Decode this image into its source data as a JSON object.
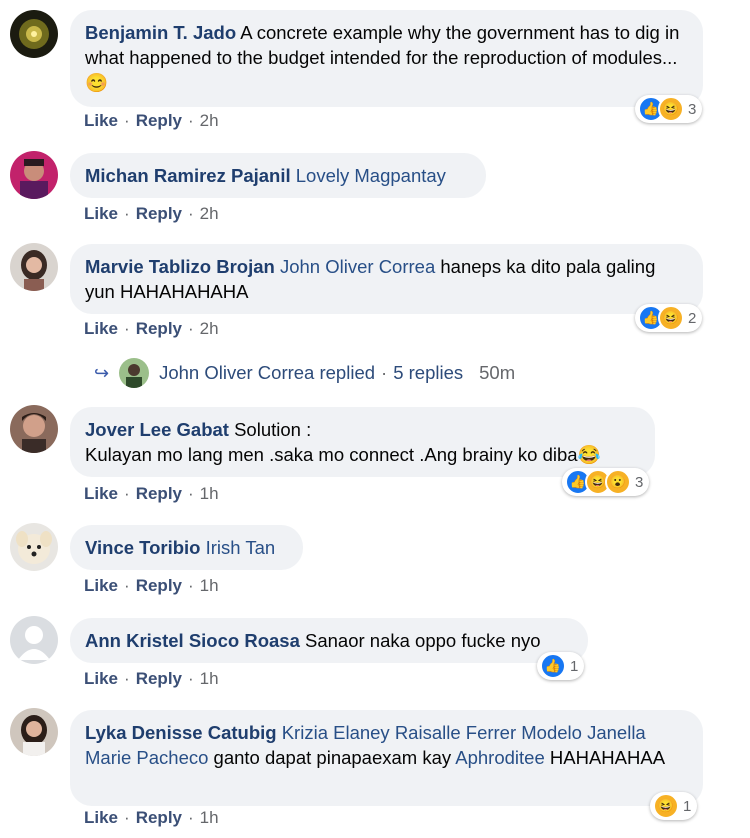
{
  "comments": [
    {
      "author": "Benjamin T. Jado",
      "text": "A concrete example why the government has to dig in what happened to the budget intended for the reproduction of modules...",
      "emoji": "😊",
      "actions": {
        "like": "Like",
        "reply": "Reply",
        "time": "2h"
      },
      "reactions": {
        "icons": [
          "like",
          "haha"
        ],
        "count": "3"
      }
    },
    {
      "author": "Michan Ramirez Pajanil",
      "tag": "Lovely Magpantay",
      "actions": {
        "like": "Like",
        "reply": "Reply",
        "time": "2h"
      }
    },
    {
      "author": "Marvie Tablizo Brojan",
      "tag": "John Oliver Correa",
      "text": "haneps ka dito pala galing yun HAHAHAHAHA",
      "actions": {
        "like": "Like",
        "reply": "Reply",
        "time": "2h"
      },
      "reactions": {
        "icons": [
          "like",
          "haha"
        ],
        "count": "2"
      },
      "replies": {
        "name": "John Oliver Correa replied",
        "count": "5 replies",
        "time": "50m"
      }
    },
    {
      "author": "Jover Lee Gabat",
      "text": "Solution :",
      "text2": "Kulayan mo lang men .saka mo connect .Ang brainy ko diba",
      "emoji": "😂",
      "actions": {
        "like": "Like",
        "reply": "Reply",
        "time": "1h"
      },
      "reactions": {
        "icons": [
          "like",
          "haha",
          "wow"
        ],
        "count": "3"
      }
    },
    {
      "author": "Vince Toribio",
      "tag": "Irish Tan",
      "actions": {
        "like": "Like",
        "reply": "Reply",
        "time": "1h"
      }
    },
    {
      "author": "Ann Kristel Sioco Roasa",
      "text": "Sanaor naka oppo fucke nyo",
      "actions": {
        "like": "Like",
        "reply": "Reply",
        "time": "1h"
      },
      "reactions": {
        "icons": [
          "like"
        ],
        "count": "1"
      }
    },
    {
      "author": "Lyka Denisse Catubig",
      "tag": "Krizia Elaney Raisalle Ferrer Modelo Janella Marie Pacheco",
      "text": "ganto dapat pinapaexam kay",
      "tag2": "Aphroditee",
      "text2": "HAHAHAHAA",
      "actions": {
        "like": "Like",
        "reply": "Reply",
        "time": "1h"
      },
      "reactions": {
        "icons": [
          "haha"
        ],
        "count": "1"
      }
    }
  ],
  "colors": {
    "bubble": "#f0f2f5",
    "author": "#1f3e6e",
    "link": "#3b4f76",
    "like": "#1877f2",
    "haha": "#f7b125"
  }
}
